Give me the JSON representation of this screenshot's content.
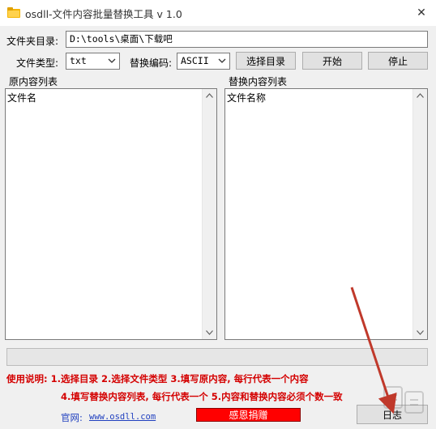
{
  "window": {
    "title": "osdll-文件内容批量替换工具 v 1.0",
    "close_glyph": "✕",
    "icon": "folder-icon"
  },
  "folder": {
    "label": "文件夹目录:",
    "value": "D:\\tools\\桌面\\下载吧"
  },
  "options": {
    "file_type_label": "文件类型:",
    "file_type_value": "txt",
    "encoding_label": "替换编码:",
    "encoding_value": "ASCII"
  },
  "buttons": {
    "select_dir": "选择目录",
    "start": "开始",
    "stop": "停止",
    "donate": "感恩捐赠",
    "log": "日志"
  },
  "panels": {
    "original_label": "原内容列表",
    "original_content": "文件名",
    "replace_label": "替换内容列表",
    "replace_content": "文件名称"
  },
  "instructions": {
    "line1": "使用说明: 1.选择目录  2.选择文件类型  3.填写原内容, 每行代表一个内容",
    "line2": "4.填写替换内容列表, 每行代表一个  5.内容和替换内容必须个数一致"
  },
  "footer": {
    "site_label": "官网:",
    "site_url": "www.osdll.com"
  },
  "colors": {
    "instructions": "#d40000",
    "donate_bg": "#ff0000",
    "link": "#1f3fbf",
    "annotation_arrow": "#c0392b"
  }
}
